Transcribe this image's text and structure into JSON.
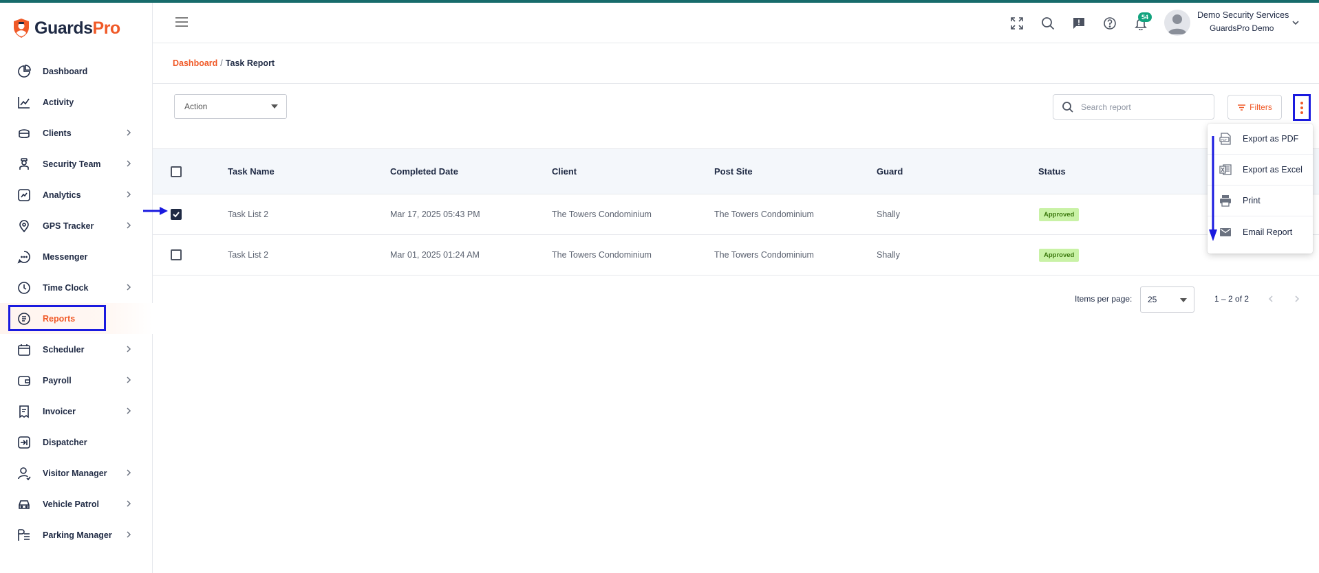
{
  "app": {
    "logo_text_dark": "Guards",
    "logo_text_accent": "Pro",
    "accent_color": "#f05a28",
    "annotation_color": "#1a1adf"
  },
  "sidebar": {
    "items": [
      {
        "label": "Dashboard",
        "icon": "chart-pie-icon",
        "has_submenu": false,
        "active": false
      },
      {
        "label": "Activity",
        "icon": "activity-trend-icon",
        "has_submenu": false,
        "active": false
      },
      {
        "label": "Clients",
        "icon": "clients-icon",
        "has_submenu": true,
        "active": false
      },
      {
        "label": "Security Team",
        "icon": "security-guard-icon",
        "has_submenu": true,
        "active": false
      },
      {
        "label": "Analytics",
        "icon": "analytics-icon",
        "has_submenu": true,
        "active": false
      },
      {
        "label": "GPS Tracker",
        "icon": "map-pin-icon",
        "has_submenu": true,
        "active": false
      },
      {
        "label": "Messenger",
        "icon": "chat-icon",
        "has_submenu": false,
        "active": false
      },
      {
        "label": "Time Clock",
        "icon": "clock-icon",
        "has_submenu": true,
        "active": false
      },
      {
        "label": "Reports",
        "icon": "document-icon",
        "has_submenu": false,
        "active": true
      },
      {
        "label": "Scheduler",
        "icon": "calendar-icon",
        "has_submenu": true,
        "active": false
      },
      {
        "label": "Payroll",
        "icon": "wallet-icon",
        "has_submenu": true,
        "active": false
      },
      {
        "label": "Invoicer",
        "icon": "invoice-icon",
        "has_submenu": true,
        "active": false
      },
      {
        "label": "Dispatcher",
        "icon": "dispatch-icon",
        "has_submenu": false,
        "active": false
      },
      {
        "label": "Visitor Manager",
        "icon": "visitor-icon",
        "has_submenu": true,
        "active": false
      },
      {
        "label": "Vehicle Patrol",
        "icon": "car-icon",
        "has_submenu": true,
        "active": false
      },
      {
        "label": "Parking Manager",
        "icon": "parking-icon",
        "has_submenu": true,
        "active": false
      }
    ]
  },
  "header": {
    "notification_count": "54",
    "user_name": "Demo Security Services",
    "user_org": "GuardsPro Demo",
    "icons": [
      "fullscreen-icon",
      "search-icon",
      "feedback-icon",
      "help-icon",
      "bell-icon"
    ]
  },
  "breadcrumb": {
    "home": "Dashboard",
    "separator": "/",
    "current": "Task Report"
  },
  "toolbar": {
    "action_label": "Action",
    "search_placeholder": "Search report",
    "filters_label": "Filters"
  },
  "table": {
    "columns": [
      "Task Name",
      "Completed Date",
      "Client",
      "Post Site",
      "Guard",
      "Status"
    ],
    "rows": [
      {
        "checked": true,
        "task_name": "Task List 2",
        "completed_date": "Mar 17, 2025 05:43 PM",
        "client": "The Towers Condominium",
        "post_site": "The Towers Condominium",
        "guard": "Shally",
        "status": "Approved"
      },
      {
        "checked": false,
        "task_name": "Task List 2",
        "completed_date": "Mar 01, 2025 01:24 AM",
        "client": "The Towers Condominium",
        "post_site": "The Towers Condominium",
        "guard": "Shally",
        "status": "Approved"
      }
    ]
  },
  "paginator": {
    "items_per_page_label": "Items per page:",
    "items_per_page_value": "25",
    "range_label": "1 – 2 of 2"
  },
  "export_menu": {
    "items": [
      {
        "label": "Export as PDF",
        "icon": "pdf-file-icon"
      },
      {
        "label": "Export as Excel",
        "icon": "excel-file-icon"
      },
      {
        "label": "Print",
        "icon": "printer-icon"
      },
      {
        "label": "Email Report",
        "icon": "envelope-icon"
      }
    ]
  }
}
